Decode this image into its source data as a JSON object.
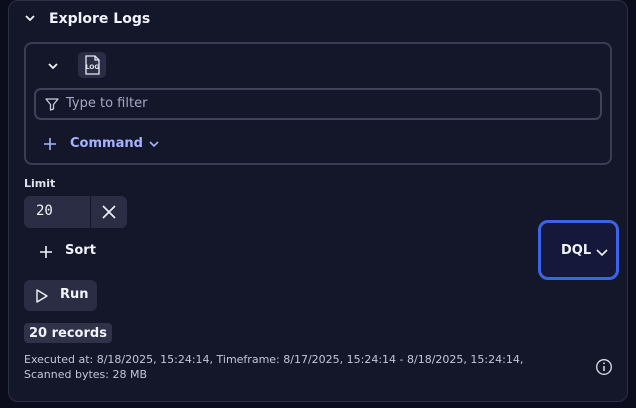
{
  "header": {
    "title": "Explore Logs"
  },
  "source": {
    "icon_text": "LOG"
  },
  "filter": {
    "placeholder": "Type to filter"
  },
  "command": {
    "label": "Command"
  },
  "limit": {
    "label": "Limit",
    "value": "20"
  },
  "sort": {
    "label": "Sort"
  },
  "query_language": {
    "label": "DQL"
  },
  "run": {
    "label": "Run"
  },
  "results": {
    "records": "20 records",
    "meta": "Executed at: 8/18/2025, 15:24:14, Timeframe: 8/17/2025, 15:24:14 - 8/18/2025, 15:24:14, Scanned bytes: 28 MB"
  },
  "colors": {
    "accent": "#3d63e8",
    "link": "#a9b2ff",
    "panel": "#14162a",
    "background": "#0b0d1c"
  },
  "icons": [
    "chevron-down-icon",
    "log-file-icon",
    "filter-icon",
    "plus-icon",
    "close-icon",
    "play-icon",
    "info-icon"
  ]
}
